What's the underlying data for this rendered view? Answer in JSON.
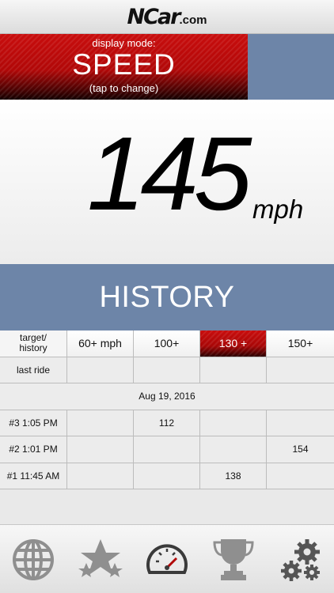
{
  "brand": {
    "name": "NCar",
    "domain": ".com"
  },
  "mode": {
    "caption": "display mode:",
    "value": "SPEED",
    "hint": "(tap to change)"
  },
  "speed": {
    "value": "145",
    "unit": "mph"
  },
  "history_title": "HISTORY",
  "table": {
    "header": [
      "target/\nhistory",
      "60+ mph",
      "100+",
      "130 +",
      "150+"
    ],
    "selected_column": 3,
    "last_ride": {
      "label": "last ride",
      "values": [
        "",
        "",
        "",
        ""
      ]
    },
    "date": "Aug 19, 2016",
    "rides": [
      {
        "label": "#3 1:05 PM",
        "values": [
          "",
          "112",
          "",
          ""
        ]
      },
      {
        "label": "#2 1:01 PM",
        "values": [
          "",
          "",
          "",
          "154"
        ]
      },
      {
        "label": "#1 11:45 AM",
        "values": [
          "",
          "",
          "138",
          ""
        ]
      }
    ]
  },
  "tabs": [
    "globe-icon",
    "stars-icon",
    "speedometer-icon",
    "trophy-icon",
    "gears-icon"
  ],
  "colors": {
    "accent_red": "#b10808",
    "blue_panel": "#6d85a8",
    "icon_gray": "#8f8f8f"
  }
}
